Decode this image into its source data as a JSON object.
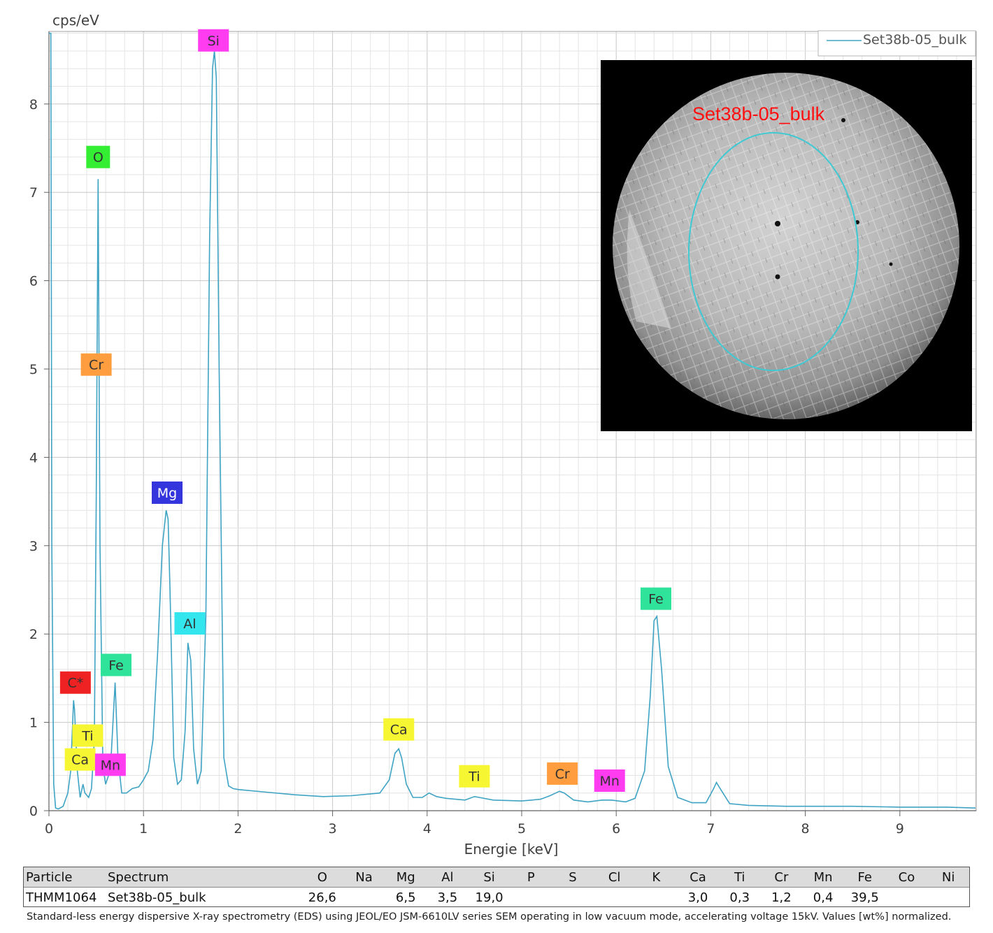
{
  "chart_data": {
    "type": "line",
    "title": "",
    "xlabel": "Energie [keV]",
    "ylabel": "cps/eV",
    "xlim": [
      0,
      9.8
    ],
    "ylim": [
      0,
      8.8
    ],
    "x_ticks": [
      "0",
      "1",
      "2",
      "3",
      "4",
      "5",
      "6",
      "7",
      "8",
      "9"
    ],
    "y_ticks": [
      "0",
      "1",
      "2",
      "3",
      "4",
      "5",
      "6",
      "7",
      "8"
    ],
    "grid": true,
    "legend_position": "top-right",
    "series": [
      {
        "name": "Set38b-05_bulk",
        "color": "#3fa3c4",
        "x": [
          0.0,
          0.02,
          0.03,
          0.05,
          0.07,
          0.1,
          0.15,
          0.2,
          0.23,
          0.26,
          0.27,
          0.3,
          0.33,
          0.36,
          0.38,
          0.42,
          0.45,
          0.48,
          0.5,
          0.52,
          0.54,
          0.57,
          0.6,
          0.63,
          0.66,
          0.7,
          0.73,
          0.77,
          0.82,
          0.88,
          0.95,
          1.0,
          1.05,
          1.1,
          1.15,
          1.2,
          1.24,
          1.26,
          1.28,
          1.32,
          1.36,
          1.4,
          1.44,
          1.47,
          1.5,
          1.53,
          1.57,
          1.61,
          1.66,
          1.7,
          1.73,
          1.75,
          1.77,
          1.8,
          1.85,
          1.9,
          1.95,
          2.0,
          2.3,
          2.6,
          2.9,
          3.2,
          3.5,
          3.6,
          3.66,
          3.7,
          3.73,
          3.78,
          3.85,
          3.95,
          4.02,
          4.1,
          4.2,
          4.4,
          4.5,
          4.55,
          4.7,
          5.0,
          5.2,
          5.3,
          5.4,
          5.45,
          5.55,
          5.7,
          5.85,
          5.95,
          6.1,
          6.2,
          6.3,
          6.36,
          6.4,
          6.43,
          6.48,
          6.55,
          6.65,
          6.8,
          6.95,
          7.03,
          7.06,
          7.1,
          7.2,
          7.4,
          7.8,
          8.5,
          9.0,
          9.5,
          9.8
        ],
        "y": [
          8.8,
          8.8,
          3.0,
          0.3,
          0.03,
          0.02,
          0.05,
          0.2,
          0.45,
          1.25,
          1.15,
          0.45,
          0.15,
          0.3,
          0.2,
          0.15,
          0.25,
          0.8,
          3.5,
          7.15,
          3.0,
          0.5,
          0.3,
          0.4,
          0.65,
          1.45,
          0.6,
          0.2,
          0.2,
          0.25,
          0.27,
          0.35,
          0.45,
          0.8,
          1.8,
          3.0,
          3.4,
          3.3,
          2.5,
          0.6,
          0.3,
          0.35,
          0.9,
          1.9,
          1.7,
          0.7,
          0.3,
          0.45,
          2.2,
          6.5,
          8.4,
          8.6,
          8.3,
          5.0,
          0.6,
          0.28,
          0.25,
          0.24,
          0.21,
          0.18,
          0.16,
          0.17,
          0.2,
          0.35,
          0.65,
          0.7,
          0.6,
          0.3,
          0.15,
          0.15,
          0.2,
          0.16,
          0.14,
          0.12,
          0.16,
          0.15,
          0.12,
          0.11,
          0.13,
          0.17,
          0.22,
          0.2,
          0.12,
          0.1,
          0.12,
          0.12,
          0.1,
          0.14,
          0.45,
          1.3,
          2.15,
          2.2,
          1.6,
          0.5,
          0.15,
          0.09,
          0.09,
          0.25,
          0.32,
          0.25,
          0.08,
          0.06,
          0.05,
          0.05,
          0.04,
          0.04,
          0.03
        ]
      }
    ],
    "peak_labels": [
      {
        "text": "Si",
        "x": 1.74,
        "y": 8.72,
        "color": "#ff3cf0"
      },
      {
        "text": "O",
        "x": 0.52,
        "y": 7.4,
        "color": "#33ee33"
      },
      {
        "text": "Cr",
        "x": 0.5,
        "y": 5.05,
        "color": "#ff9d3f"
      },
      {
        "text": "Mg",
        "x": 1.25,
        "y": 3.6,
        "color": "#3535dd"
      },
      {
        "text": "Al",
        "x": 1.49,
        "y": 2.12,
        "color": "#33e6ee"
      },
      {
        "text": "Fe",
        "x": 0.71,
        "y": 1.65,
        "color": "#2fe39b"
      },
      {
        "text": "C*",
        "x": 0.28,
        "y": 1.45,
        "color": "#ee2222"
      },
      {
        "text": "Ti",
        "x": 0.41,
        "y": 0.85,
        "color": "#f6f633"
      },
      {
        "text": "Ca",
        "x": 0.33,
        "y": 0.58,
        "color": "#f6f633"
      },
      {
        "text": "Mn",
        "x": 0.65,
        "y": 0.52,
        "color": "#ff3cf0"
      },
      {
        "text": "Ca",
        "x": 3.7,
        "y": 0.92,
        "color": "#f6f633"
      },
      {
        "text": "Ti",
        "x": 4.5,
        "y": 0.39,
        "color": "#f6f633"
      },
      {
        "text": "Cr",
        "x": 5.43,
        "y": 0.42,
        "color": "#ff9d3f"
      },
      {
        "text": "Mn",
        "x": 5.93,
        "y": 0.34,
        "color": "#ff3cf0"
      },
      {
        "text": "Fe",
        "x": 6.42,
        "y": 2.4,
        "color": "#2fe39b"
      }
    ]
  },
  "inset": {
    "label": "Set38b-05_bulk",
    "label_color": "#ff1010",
    "ellipse_color": "#3ec9d3",
    "background": "#000000"
  },
  "table": {
    "headers": [
      "Particle",
      "Spectrum",
      "O",
      "Na",
      "Mg",
      "Al",
      "Si",
      "P",
      "S",
      "Cl",
      "K",
      "Ca",
      "Ti",
      "Cr",
      "Mn",
      "Fe",
      "Co",
      "Ni"
    ],
    "rows": [
      [
        "THMM1064",
        "Set38b-05_bulk",
        "26,6",
        "",
        "6,5",
        "3,5",
        "19,0",
        "",
        "",
        "",
        "",
        "3,0",
        "0,3",
        "1,2",
        "0,4",
        "39,5",
        "",
        ""
      ]
    ]
  },
  "footnote": "Standard-less energy dispersive X-ray spectrometry (EDS) using JEOL/EO JSM-6610LV series SEM operating in low vacuum mode, accelerating voltage 15kV. Values [wt%] normalized."
}
